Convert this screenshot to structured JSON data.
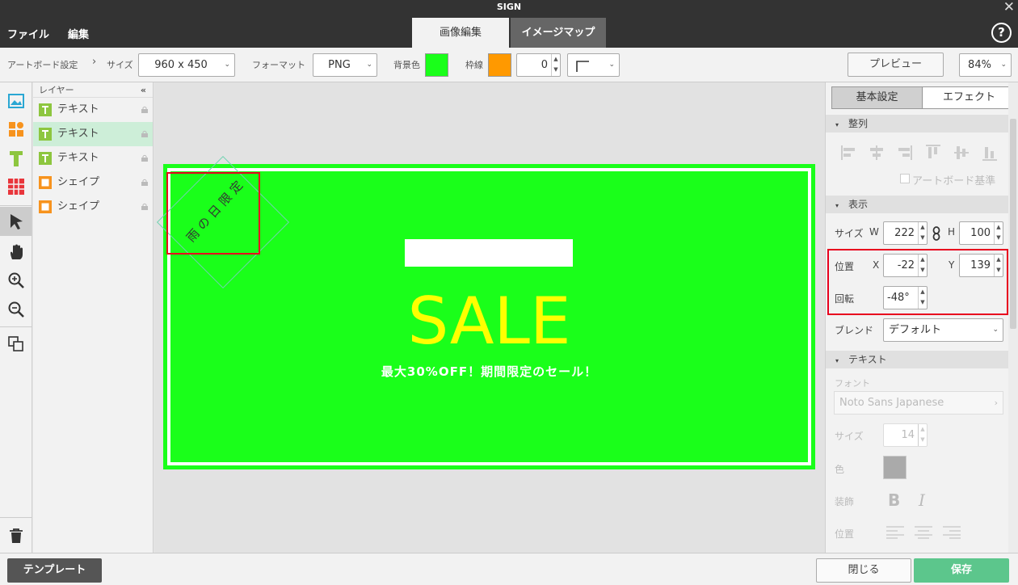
{
  "app": {
    "title": "SIGN",
    "close_glyph": "✕"
  },
  "menu": {
    "file": "ファイル",
    "edit": "編集",
    "help_glyph": "?"
  },
  "tabs": {
    "image_edit": "画像編集",
    "image_map": "イメージマップ"
  },
  "toolbar": {
    "breadcrumb": "アートボード設定",
    "breadcrumb_sep": "›",
    "size_label": "サイズ",
    "size_value": "960 x 450",
    "format_label": "フォーマット",
    "format_value": "PNG",
    "bg_label": "背景色",
    "bg_color": "#1aff1a",
    "border_label": "枠線",
    "border_color": "#ff9900",
    "border_width": "0",
    "preview_label": "プレビュー",
    "zoom_value": "84%"
  },
  "layers": {
    "header": "レイヤー",
    "collapse_glyph": "«",
    "items": [
      {
        "name": "テキスト",
        "type": "text"
      },
      {
        "name": "テキスト",
        "type": "text",
        "selected": true
      },
      {
        "name": "テキスト",
        "type": "text"
      },
      {
        "name": "シェイプ",
        "type": "shape"
      },
      {
        "name": "シェイプ",
        "type": "shape"
      }
    ]
  },
  "canvas": {
    "badge_text": "雨の日限定",
    "sale_text": "SALE",
    "sub_text": "最大30%OFF！期間限定のセール！",
    "bg_color": "#1aff1a",
    "sale_color": "#ffff00"
  },
  "right": {
    "tab_basic": "基本設定",
    "tab_effect": "エフェクト",
    "sec_align": "整列",
    "artboard_ref": "アートボード基準",
    "sec_display": "表示",
    "size_label": "サイズ",
    "w_label": "W",
    "w_value": "222",
    "h_label": "H",
    "h_value": "100",
    "pos_label": "位置",
    "x_label": "X",
    "x_value": "-22",
    "y_label": "Y",
    "y_value": "139",
    "rot_label": "回転",
    "rot_value": "-48°",
    "blend_label": "ブレンド",
    "blend_value": "デフォルト",
    "sec_text": "テキスト",
    "font_label": "フォント",
    "font_value": "Noto Sans Japanese",
    "font_size_label": "サイズ",
    "font_size_value": "14",
    "color_label": "色",
    "deco_label": "装飾",
    "bold_glyph": "B",
    "italic_glyph": "I",
    "align_label": "位置"
  },
  "footer": {
    "template": "テンプレート",
    "close": "閉じる",
    "save": "保存"
  }
}
